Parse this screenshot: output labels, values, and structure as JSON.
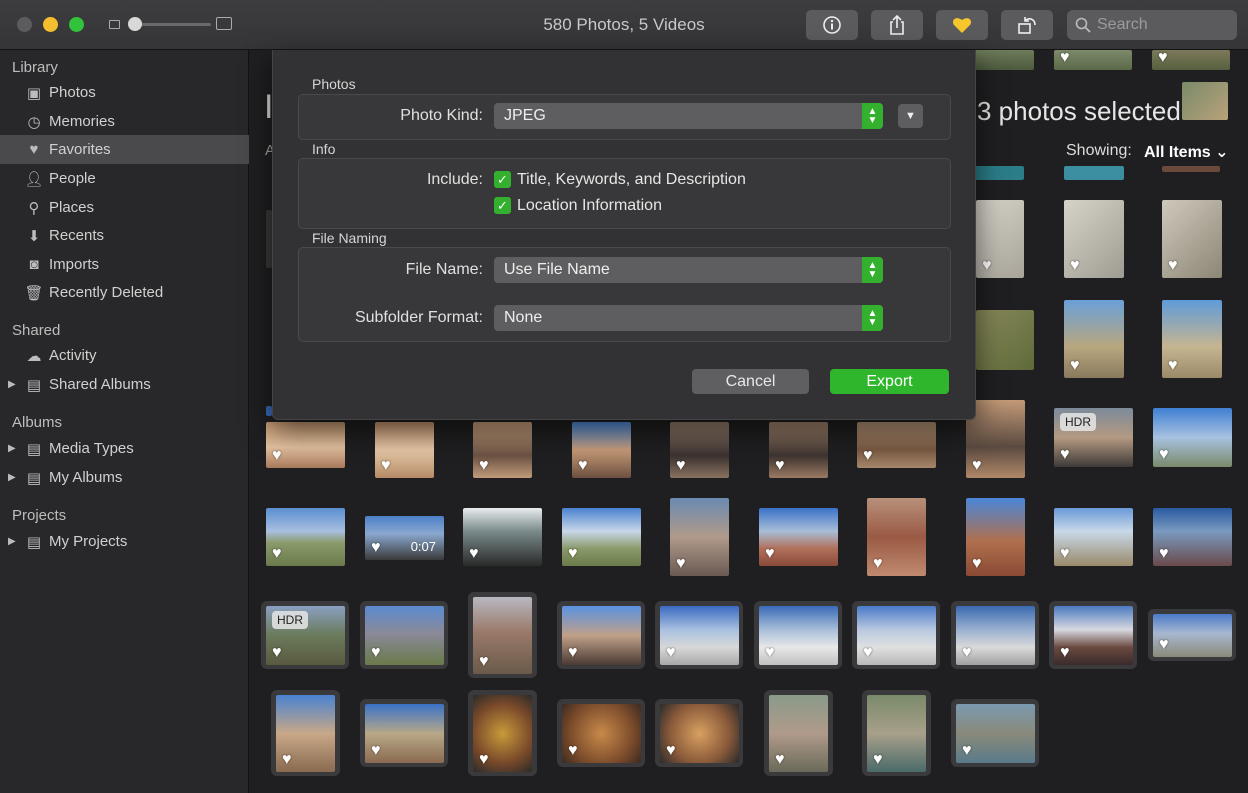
{
  "window": {
    "title": "580 Photos, 5 Videos"
  },
  "toolbar": {
    "search_placeholder": "Search"
  },
  "sidebar": {
    "library_label": "Library",
    "library_items": [
      {
        "label": "Photos",
        "icon": "photos-icon"
      },
      {
        "label": "Memories",
        "icon": "memories-icon"
      },
      {
        "label": "Favorites",
        "icon": "heart-icon",
        "selected": true
      },
      {
        "label": "People",
        "icon": "person-icon"
      },
      {
        "label": "Places",
        "icon": "pin-icon"
      },
      {
        "label": "Recents",
        "icon": "recents-icon"
      },
      {
        "label": "Imports",
        "icon": "camera-icon"
      },
      {
        "label": "Recently Deleted",
        "icon": "trash-icon"
      }
    ],
    "shared_label": "Shared",
    "shared_items": [
      {
        "label": "Activity",
        "icon": "cloud-icon"
      },
      {
        "label": "Shared Albums",
        "icon": "folder-icon"
      }
    ],
    "albums_label": "Albums",
    "albums_items": [
      {
        "label": "Media Types",
        "icon": "folder-icon"
      },
      {
        "label": "My Albums",
        "icon": "folder-icon"
      }
    ],
    "projects_label": "Projects",
    "projects_items": [
      {
        "label": "My Projects",
        "icon": "folder-icon"
      }
    ]
  },
  "main": {
    "selected_text": "3 photos selected",
    "showing_label": "Showing:",
    "showing_value": "All Items",
    "title_fragment": "I",
    "subtitle_fragment": "A",
    "badges": {
      "hdr": "HDR",
      "video_duration": "0:07"
    }
  },
  "dialog": {
    "photos_section": "Photos",
    "photo_kind_label": "Photo Kind:",
    "photo_kind_value": "JPEG",
    "info_section": "Info",
    "include_label": "Include:",
    "include_options": [
      "Title, Keywords, and Description",
      "Location Information"
    ],
    "file_naming_section": "File Naming",
    "file_name_label": "File Name:",
    "file_name_value": "Use File Name",
    "subfolder_label": "Subfolder Format:",
    "subfolder_value": "None",
    "cancel_label": "Cancel",
    "export_label": "Export"
  },
  "colors": {
    "accent_green": "#33b12e",
    "favorite_yellow": "#f5c62d"
  }
}
